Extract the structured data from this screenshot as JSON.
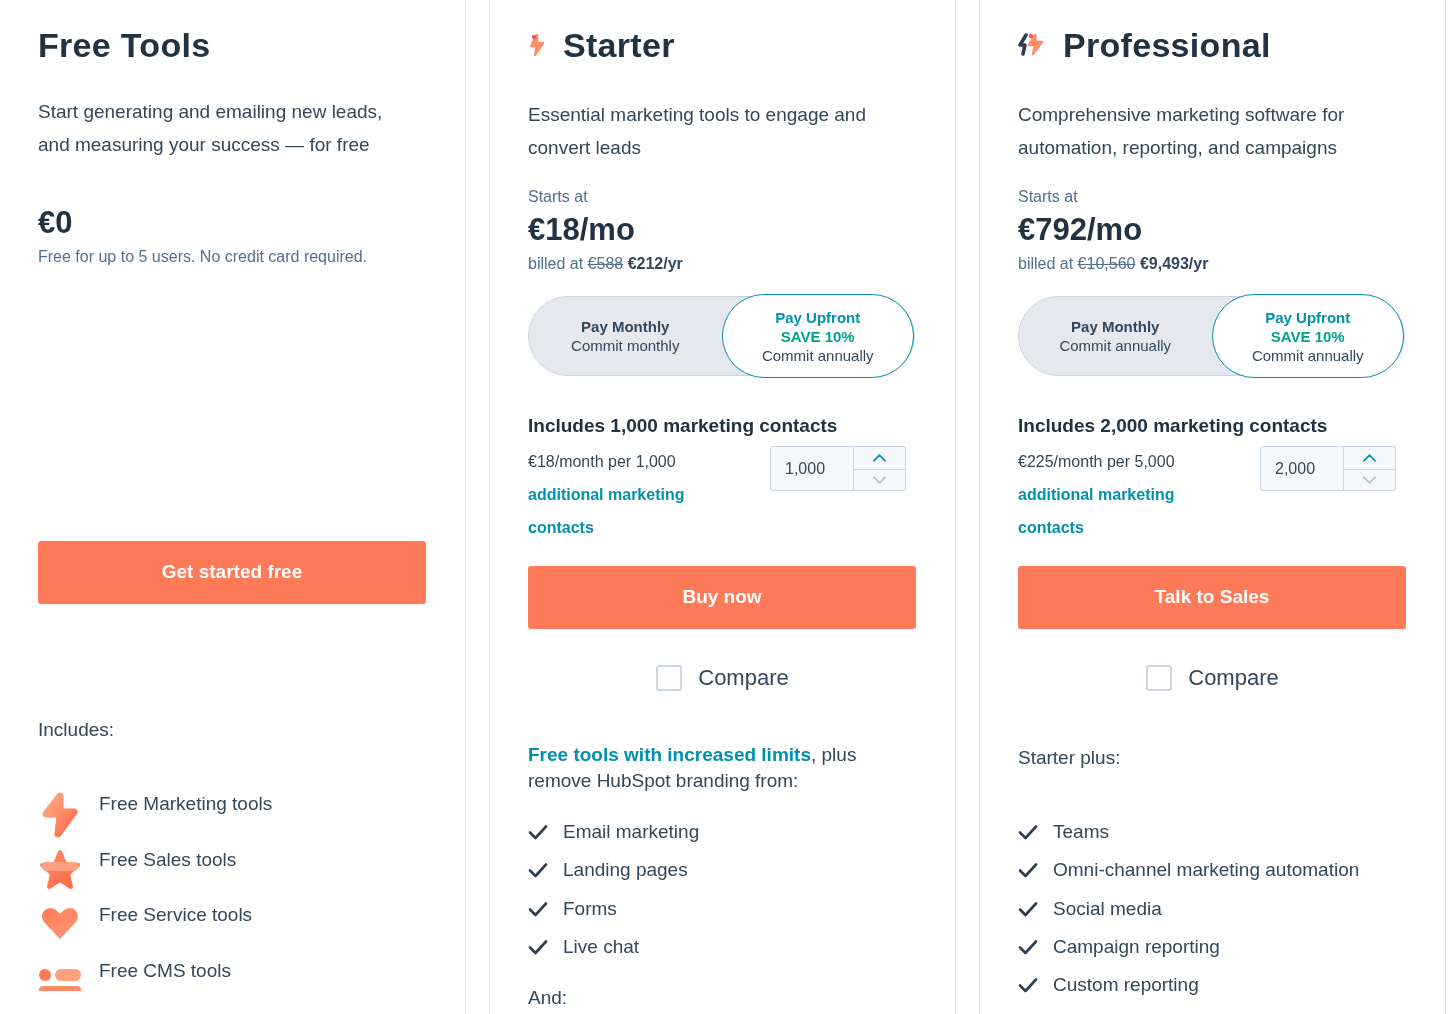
{
  "plans": [
    {
      "kind": "free",
      "name": "Free Tools",
      "description": "Start generating and emailing new leads, and measuring your success — for free",
      "price": "€0",
      "price_note": "Free for up to 5 users. No credit card required.",
      "cta": "Get started free",
      "features": {
        "heading": "Includes:",
        "items": [
          "Free Marketing tools",
          "Free Sales tools",
          "Free Service tools",
          "Free CMS tools"
        ]
      }
    },
    {
      "kind": "starter",
      "name": "Starter",
      "description": "Essential marketing tools to engage and convert leads",
      "starts_at": "Starts at",
      "price": "€18/mo",
      "billing": {
        "prefix": "billed at",
        "old_price": "€588",
        "new_price": "€212/yr"
      },
      "billing_options": [
        {
          "title": "Pay Monthly",
          "subtitle": "Commit monthly",
          "selected": false
        },
        {
          "title": "Pay Upfront",
          "badge": "SAVE 10%",
          "subtitle": "Commit annually",
          "selected": true
        }
      ],
      "contacts": {
        "heading": "Includes 1,000 marketing contacts",
        "rate": "€18/month per 1,000",
        "link": "additional marketing contacts",
        "value": "1,000",
        "decrease_disabled": true
      },
      "cta": "Buy now",
      "compare": {
        "label": "Compare",
        "checked": false
      },
      "features": {
        "intro_link": "Free tools with increased limits",
        "intro": ", plus remove HubSpot branding from:",
        "items": [
          "Email marketing",
          "Landing pages",
          "Forms",
          "Live chat"
        ],
        "footer": "And:"
      }
    },
    {
      "kind": "professional",
      "name": "Professional",
      "description": "Comprehensive marketing software for automation, reporting, and campaigns",
      "starts_at": "Starts at",
      "price": "€792/mo",
      "billing": {
        "prefix": "billed at",
        "old_price": "€10,560",
        "new_price": "€9,493/yr"
      },
      "billing_options": [
        {
          "title": "Pay Monthly",
          "subtitle": "Commit annually",
          "selected": false
        },
        {
          "title": "Pay Upfront",
          "badge": "SAVE 10%",
          "subtitle": "Commit annually",
          "selected": true
        }
      ],
      "contacts": {
        "heading": "Includes 2,000 marketing contacts",
        "rate": "€225/month per 5,000",
        "link": "additional marketing contacts",
        "value": "2,000",
        "decrease_disabled": true
      },
      "cta": "Talk to Sales",
      "compare": {
        "label": "Compare",
        "checked": false
      },
      "features": {
        "heading": "Starter plus:",
        "items": [
          "Teams",
          "Omni-channel marketing automation",
          "Social media",
          "Campaign reporting",
          "Custom reporting"
        ]
      }
    }
  ]
}
